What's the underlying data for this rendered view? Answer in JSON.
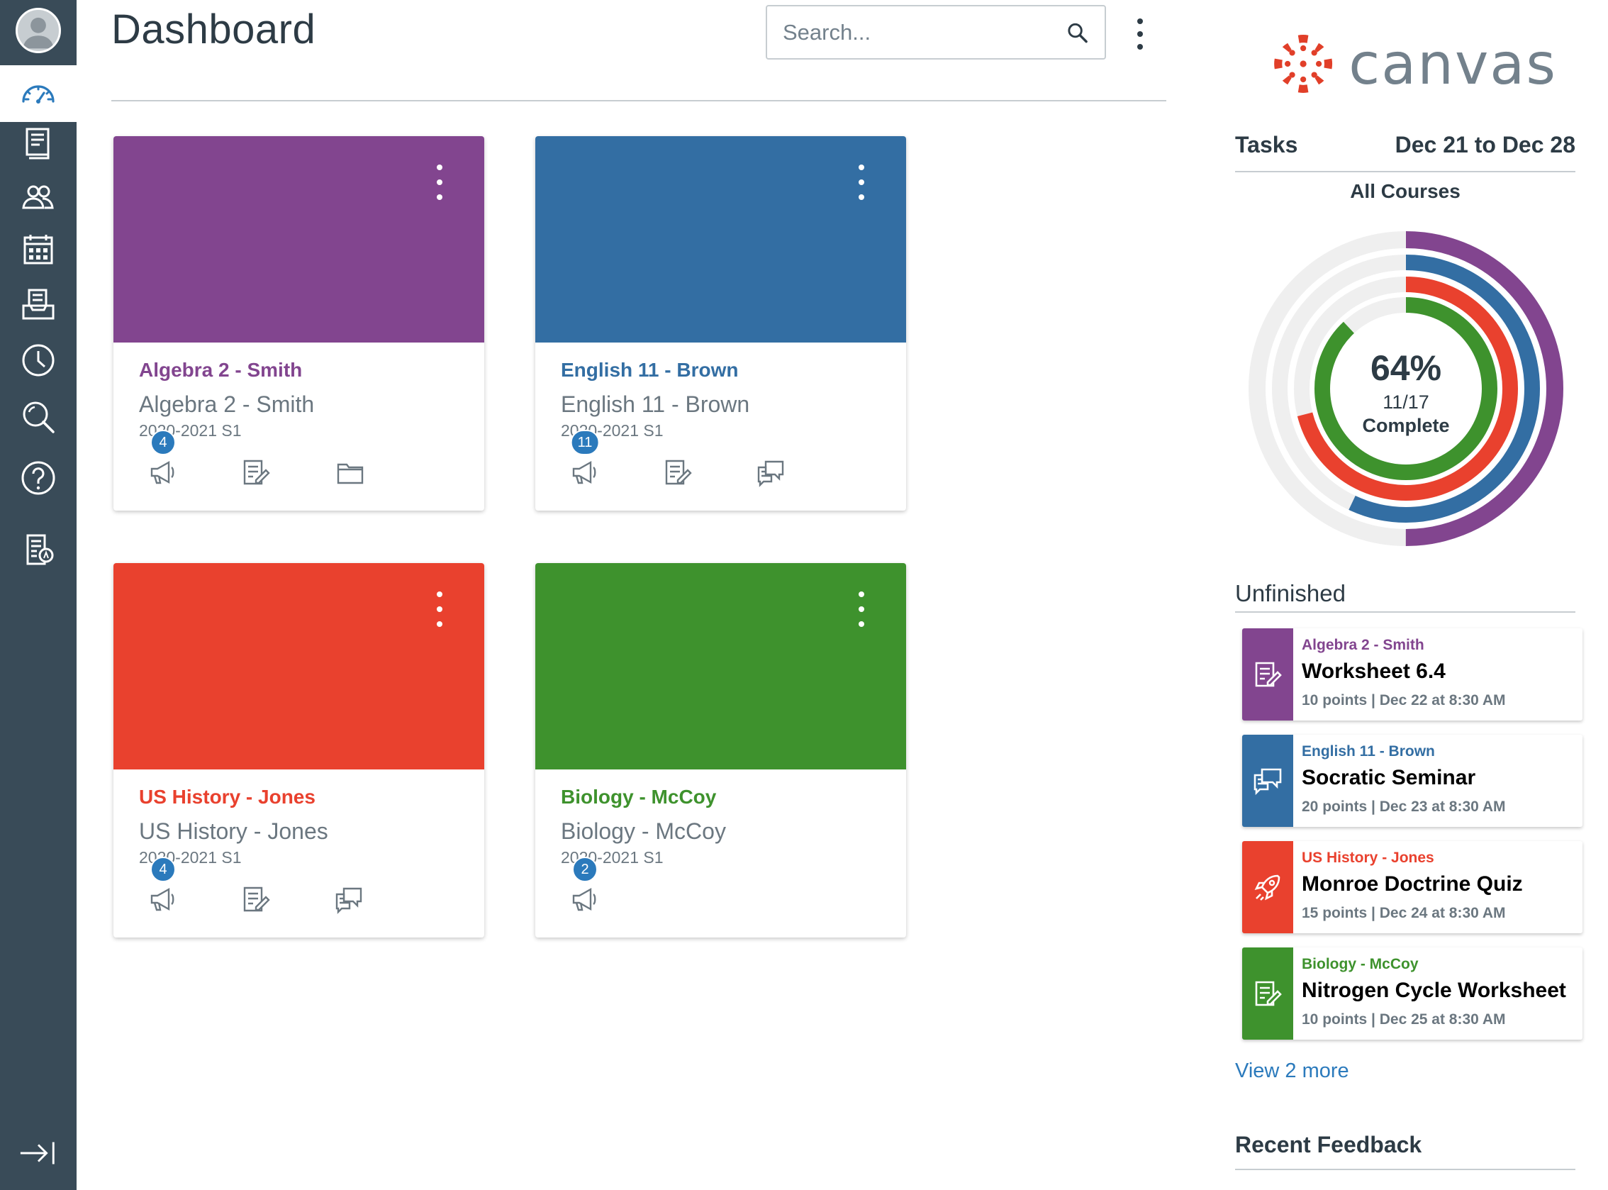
{
  "header": {
    "title": "Dashboard",
    "search_placeholder": "Search..."
  },
  "nav": {
    "items": [
      "avatar-icon",
      "dashboard-icon",
      "courses-icon",
      "groups-icon",
      "calendar-icon",
      "inbox-icon",
      "history-icon",
      "search-icon",
      "help-icon",
      "studio-icon",
      "collapse-icon"
    ],
    "active": "dashboard"
  },
  "courses": [
    {
      "title": "Algebra 2 - Smith",
      "subtitle": "Algebra 2 - Smith",
      "term": "2020-2021 S1",
      "color": "#82458f",
      "announcements_badge": "4",
      "icons": [
        "announcements-icon",
        "assignments-icon",
        "files-icon"
      ]
    },
    {
      "title": "English 11 - Brown",
      "subtitle": "English 11 - Brown",
      "term": "2020-2021 S1",
      "color": "#336ea3",
      "announcements_badge": "11",
      "icons": [
        "announcements-icon",
        "assignments-icon",
        "discussions-icon"
      ]
    },
    {
      "title": "US History - Jones",
      "subtitle": "US History - Jones",
      "term": "2020-2021 S1",
      "color": "#e9412e",
      "announcements_badge": "4",
      "icons": [
        "announcements-icon",
        "assignments-icon",
        "discussions-icon"
      ]
    },
    {
      "title": "Biology - McCoy",
      "subtitle": "Biology - McCoy",
      "term": "2020-2021 S1",
      "color": "#3e922d",
      "announcements_badge": "2",
      "icons": [
        "announcements-icon"
      ]
    }
  ],
  "sidebar": {
    "logo_text": "canvas",
    "tasks_label": "Tasks",
    "date_range": "Dec 21 to Dec 28",
    "filter": "All Courses",
    "progress": {
      "percent_label": "64%",
      "fraction": "11/17",
      "complete_label": "Complete",
      "percent": 0.64,
      "rings": [
        {
          "color": "#82458f",
          "fraction": 0.5
        },
        {
          "color": "#336ea3",
          "fraction": 0.57
        },
        {
          "color": "#e9412e",
          "fraction": 0.71
        },
        {
          "color": "#3e922d",
          "fraction": 0.88
        }
      ]
    },
    "unfinished_label": "Unfinished",
    "unfinished": [
      {
        "course": "Algebra 2 - Smith",
        "name": "Worksheet 6.4",
        "meta": "10 points  |  Dec 22 at 8:30 AM",
        "color": "#82458f",
        "icon": "assignment-icon"
      },
      {
        "course": "English 11 - Brown",
        "name": "Socratic Seminar",
        "meta": "20 points  |  Dec 23 at 8:30 AM",
        "color": "#336ea3",
        "icon": "discussion-icon"
      },
      {
        "course": "US History - Jones",
        "name": "Monroe Doctrine Quiz",
        "meta": "15 points  |  Dec 24 at 8:30 AM",
        "color": "#e9412e",
        "icon": "quiz-rocket-icon"
      },
      {
        "course": "Biology - McCoy",
        "name": "Nitrogen Cycle Worksheet",
        "meta": "10 points  |  Dec 25 at 8:30 AM",
        "color": "#3e922d",
        "icon": "assignment-icon"
      }
    ],
    "view_more": "View 2 more",
    "recent_feedback_label": "Recent Feedback"
  }
}
